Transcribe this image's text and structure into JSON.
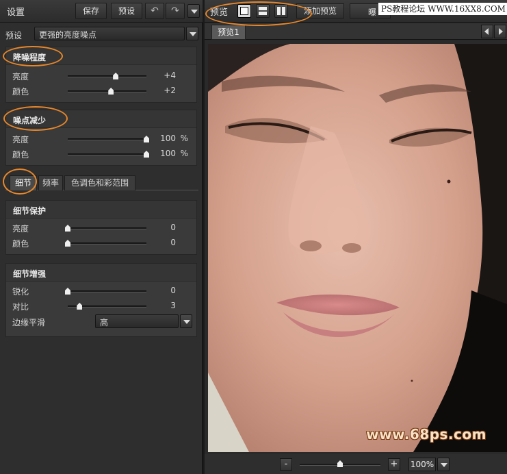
{
  "left": {
    "title": "设置",
    "save_label": "保存",
    "preset_btn_label": "预设",
    "undo_icon": "undo-icon",
    "redo_icon": "redo-icon",
    "preset": {
      "label": "预设",
      "value": "更强的亮度噪点"
    },
    "noise_group": {
      "title": "降噪程度",
      "rows": [
        {
          "label": "亮度",
          "value": "+4",
          "level": 0.61
        },
        {
          "label": "颜色",
          "value": "+2",
          "level": 0.55
        }
      ]
    },
    "reduce_group": {
      "title": "噪点减少",
      "rows": [
        {
          "label": "亮度",
          "value": "100",
          "unit": "%",
          "level": 1.0
        },
        {
          "label": "颜色",
          "value": "100",
          "unit": "%",
          "level": 1.0
        }
      ]
    },
    "tabs": [
      "细节",
      "频率",
      "色调色和彩范围"
    ],
    "active_tab": "细节",
    "detail_protect": {
      "title": "细节保护",
      "rows": [
        {
          "label": "亮度",
          "value": "0",
          "level": 0.0
        },
        {
          "label": "颜色",
          "value": "0",
          "level": 0.0
        }
      ]
    },
    "detail_enhance": {
      "title": "细节增强",
      "rows": [
        {
          "label": "锐化",
          "value": "0",
          "level": 0.0
        },
        {
          "label": "对比",
          "value": "3",
          "level": 0.15
        }
      ],
      "edge": {
        "label": "边缘平滑",
        "value": "高"
      }
    }
  },
  "right": {
    "preview_label": "预览",
    "add_preview_label": "添加预览",
    "exposure_partial": "曝",
    "watermark_top": "PS教程论坛 WWW.16XX8.COM",
    "preview_tab": "预览1",
    "watermark_bottom": "www.68ps.com",
    "zoom": {
      "minus": "-",
      "plus": "+",
      "value": "100%",
      "level": 0.5
    }
  },
  "colors": {
    "annotation": "#e8872a",
    "panel": "#2e2e2e",
    "group": "#3a3a3a"
  }
}
